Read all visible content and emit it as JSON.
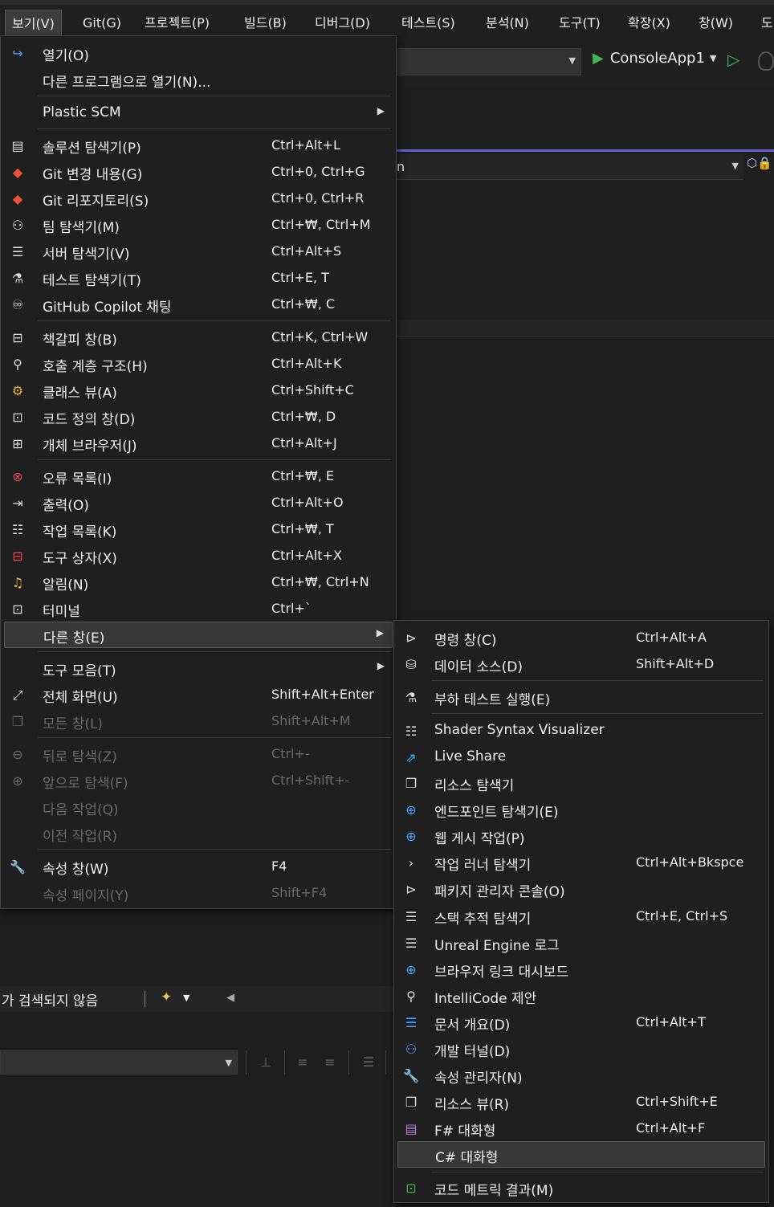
{
  "menubar": {
    "items": [
      "보기(V)",
      "Git(G)",
      "프로젝트(P)",
      "빌드(B)",
      "디버그(D)",
      "테스트(S)",
      "분석(N)",
      "도구(T)",
      "확장(X)",
      "창(W)",
      "도"
    ]
  },
  "toolbar": {
    "run_label": "ConsoleApp1",
    "nav_text": "n"
  },
  "view_menu": {
    "items": [
      {
        "icon": "redo-arrow-icon",
        "label": "열기(O)",
        "shortcut": ""
      },
      {
        "icon": "",
        "label": "다른 프로그램으로 열기(N)...",
        "shortcut": ""
      },
      {
        "icon": "",
        "label": "Plastic SCM",
        "shortcut": ""
      },
      {
        "icon": "solution-explorer-icon",
        "label": "솔루션 탐색기(P)",
        "shortcut": "Ctrl+Alt+L"
      },
      {
        "icon": "git-changes-icon",
        "label": "Git 변경 내용(G)",
        "shortcut": "Ctrl+0, Ctrl+G"
      },
      {
        "icon": "git-repository-icon",
        "label": "Git 리포지토리(S)",
        "shortcut": "Ctrl+0, Ctrl+R"
      },
      {
        "icon": "team-explorer-icon",
        "label": "팀 탐색기(M)",
        "shortcut": "Ctrl+₩, Ctrl+M"
      },
      {
        "icon": "server-explorer-icon",
        "label": "서버 탐색기(V)",
        "shortcut": "Ctrl+Alt+S"
      },
      {
        "icon": "test-explorer-icon",
        "label": "테스트 탐색기(T)",
        "shortcut": "Ctrl+E, T"
      },
      {
        "icon": "copilot-icon",
        "label": "GitHub Copilot 채팅",
        "shortcut": "Ctrl+₩, C"
      },
      {
        "icon": "bookmark-window-icon",
        "label": "책갈피 창(B)",
        "shortcut": "Ctrl+K, Ctrl+W"
      },
      {
        "icon": "call-hierarchy-icon",
        "label": "호출 계층 구조(H)",
        "shortcut": "Ctrl+Alt+K"
      },
      {
        "icon": "class-view-icon",
        "label": "클래스 뷰(A)",
        "shortcut": "Ctrl+Shift+C"
      },
      {
        "icon": "code-definition-icon",
        "label": "코드 정의 창(D)",
        "shortcut": "Ctrl+₩, D"
      },
      {
        "icon": "object-browser-icon",
        "label": "개체 브라우저(J)",
        "shortcut": "Ctrl+Alt+J"
      },
      {
        "icon": "error-list-icon",
        "label": "오류 목록(I)",
        "shortcut": "Ctrl+₩, E"
      },
      {
        "icon": "output-icon",
        "label": "출력(O)",
        "shortcut": "Ctrl+Alt+O"
      },
      {
        "icon": "task-list-icon",
        "label": "작업 목록(K)",
        "shortcut": "Ctrl+₩, T"
      },
      {
        "icon": "toolbox-icon",
        "label": "도구 상자(X)",
        "shortcut": "Ctrl+Alt+X"
      },
      {
        "icon": "bell-icon",
        "label": "알림(N)",
        "shortcut": "Ctrl+₩, Ctrl+N"
      },
      {
        "icon": "terminal-icon",
        "label": "터미널",
        "shortcut": "Ctrl+`"
      },
      {
        "icon": "",
        "label": "다른 창(E)",
        "shortcut": ""
      },
      {
        "icon": "",
        "label": "도구 모음(T)",
        "shortcut": ""
      },
      {
        "icon": "fullscreen-icon",
        "label": "전체 화면(U)",
        "shortcut": "Shift+Alt+Enter"
      },
      {
        "icon": "all-windows-icon",
        "label": "모든 창(L)",
        "shortcut": "Shift+Alt+M"
      },
      {
        "icon": "navigate-back-icon",
        "label": "뒤로 탐색(Z)",
        "shortcut": "Ctrl+-"
      },
      {
        "icon": "navigate-forward-icon",
        "label": "앞으로 탐색(F)",
        "shortcut": "Ctrl+Shift+-"
      },
      {
        "icon": "",
        "label": "다음 작업(Q)",
        "shortcut": ""
      },
      {
        "icon": "",
        "label": "이전 작업(R)",
        "shortcut": ""
      },
      {
        "icon": "wrench-icon",
        "label": "속성 창(W)",
        "shortcut": "F4"
      },
      {
        "icon": "",
        "label": "속성 페이지(Y)",
        "shortcut": "Shift+F4"
      }
    ]
  },
  "other_windows_menu": {
    "items": [
      {
        "icon": "command-window-icon",
        "label": "명령 창(C)",
        "shortcut": "Ctrl+Alt+A"
      },
      {
        "icon": "data-sources-icon",
        "label": "데이터 소스(D)",
        "shortcut": "Shift+Alt+D"
      },
      {
        "icon": "load-test-icon",
        "label": "부하 테스트 실행(E)",
        "shortcut": ""
      },
      {
        "icon": "shader-visualizer-icon",
        "label": "Shader Syntax Visualizer",
        "shortcut": ""
      },
      {
        "icon": "live-share-icon",
        "label": "Live Share",
        "shortcut": ""
      },
      {
        "icon": "resource-explorer-icon",
        "label": "리소스 탐색기",
        "shortcut": ""
      },
      {
        "icon": "globe-icon",
        "label": "엔드포인트 탐색기(E)",
        "shortcut": ""
      },
      {
        "icon": "web-publish-icon",
        "label": "웹 게시 작업(P)",
        "shortcut": ""
      },
      {
        "icon": "chevron-right-icon",
        "label": "작업 러너 탐색기",
        "shortcut": "Ctrl+Alt+Bkspce"
      },
      {
        "icon": "package-console-icon",
        "label": "패키지 관리자 콘솔(O)",
        "shortcut": ""
      },
      {
        "icon": "stack-trace-icon",
        "label": "스택 추적 탐색기",
        "shortcut": "Ctrl+E, Ctrl+S"
      },
      {
        "icon": "log-icon",
        "label": "Unreal Engine 로그",
        "shortcut": ""
      },
      {
        "icon": "browser-link-icon",
        "label": "브라우저 링크 대시보드",
        "shortcut": ""
      },
      {
        "icon": "lightbulb-icon",
        "label": "IntelliCode 제안",
        "shortcut": ""
      },
      {
        "icon": "document-outline-icon",
        "label": "문서 개요(D)",
        "shortcut": "Ctrl+Alt+T"
      },
      {
        "icon": "dev-tunnels-icon",
        "label": "개발 터널(D)",
        "shortcut": ""
      },
      {
        "icon": "wrench-icon",
        "label": "속성 관리자(N)",
        "shortcut": ""
      },
      {
        "icon": "resource-view-icon",
        "label": "리소스 뷰(R)",
        "shortcut": "Ctrl+Shift+E"
      },
      {
        "icon": "fsharp-interactive-icon",
        "label": "F# 대화형",
        "shortcut": "Ctrl+Alt+F"
      },
      {
        "icon": "",
        "label": "C# 대화형",
        "shortcut": ""
      },
      {
        "icon": "code-metrics-icon",
        "label": "코드 메트릭 결과(M)",
        "shortcut": ""
      }
    ]
  },
  "status": {
    "search_text": "가 검색되지 않음"
  }
}
